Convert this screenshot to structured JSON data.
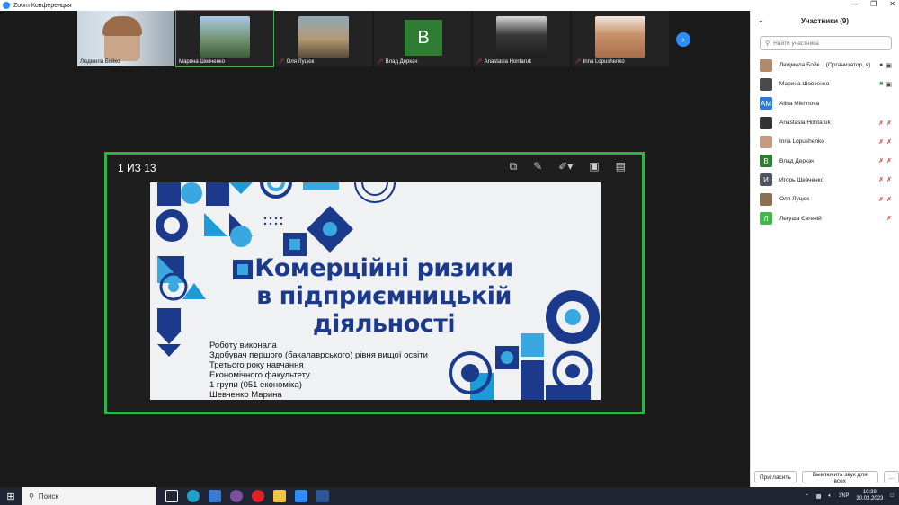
{
  "window": {
    "title": "Zoom Конференция"
  },
  "gallery": [
    {
      "name": "Людмила Бойко",
      "mic_off": false,
      "active": false
    },
    {
      "name": "Марина Шевченко",
      "mic_off": false,
      "active": true
    },
    {
      "name": "Оля Луцюк",
      "mic_off": true,
      "active": false
    },
    {
      "name": "Влад Деркач",
      "mic_off": true,
      "active": false,
      "initial": "В"
    },
    {
      "name": "Anastasia Hontaruk",
      "mic_off": true,
      "active": false
    },
    {
      "name": "Inna Lopushenko",
      "mic_off": true,
      "active": false
    }
  ],
  "share": {
    "page_indicator": "1 ИЗ 13",
    "slide_title": "Комерційні ризики в підприємницькій діяльності",
    "slide_lines": [
      "Роботу виконала",
      "Здобувач першого (бакалаврського) рівня вищої освіти",
      "Третього року навчання",
      "Економічного факультету",
      "1 групи (051 економіка)",
      "Шевченко Марина"
    ]
  },
  "sidebar": {
    "title": "Участники (9)",
    "search_placeholder": "Найти участника",
    "participants": [
      {
        "name": "Людмила Бойк... (Организатор, я)",
        "initials": "",
        "color": "#b08a6a"
      },
      {
        "name": "Марина Шевченко",
        "initials": "",
        "color": "#4a4a4a"
      },
      {
        "name": "Alina Mikhnova",
        "initials": "AM",
        "color": "#2a7bd6"
      },
      {
        "name": "Anastasia Hontaruk",
        "initials": "",
        "color": "#333333"
      },
      {
        "name": "Inna Lopushenko",
        "initials": "",
        "color": "#c59a82"
      },
      {
        "name": "Влад Деркач",
        "initials": "В",
        "color": "#2e7d32"
      },
      {
        "name": "Игорь Шевченко",
        "initials": "И",
        "color": "#4d5563"
      },
      {
        "name": "Оля Луцюк",
        "initials": "",
        "color": "#8a6f52"
      },
      {
        "name": "Легуша Євгеній",
        "initials": "Л",
        "color": "#43b649"
      }
    ],
    "invite_label": "Пригласить",
    "mute_all_label": "Выключить звук для всех",
    "more_label": "..."
  },
  "taskbar": {
    "search_label": "Поиск",
    "lang": "УКР",
    "time": "10:39",
    "date": "30.03.2023"
  }
}
